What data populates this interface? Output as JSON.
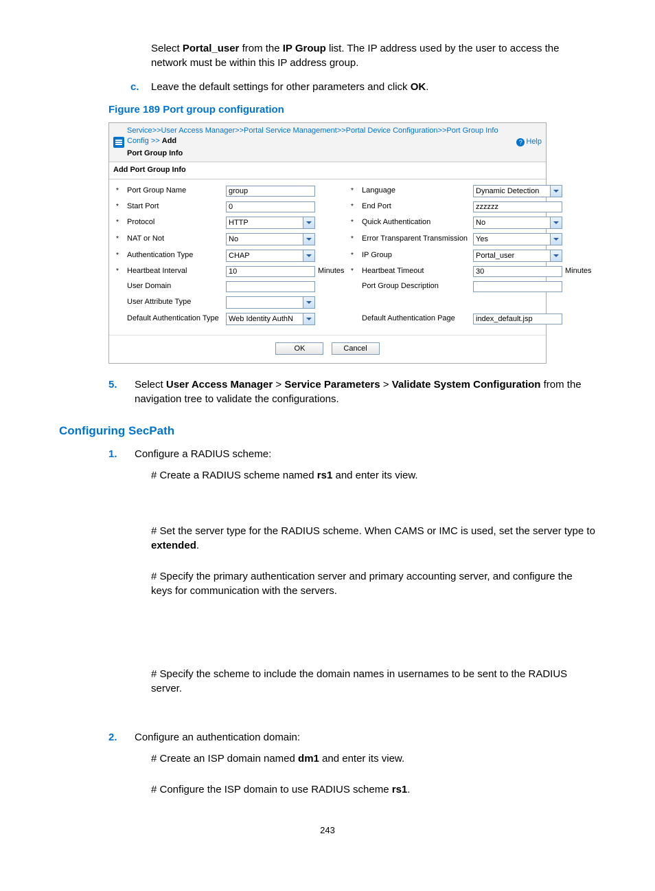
{
  "intro": {
    "para1_a": "Select ",
    "para1_b": "Portal_user",
    "para1_c": " from the ",
    "para1_d": "IP Group",
    "para1_e": " list. The IP address used by the user to access the network must be within this IP address group."
  },
  "step_c_a": "Leave the default settings for other parameters and click ",
  "step_c_b": "OK",
  "step_c_c": ".",
  "fig_caption": "Figure 189 Port group configuration",
  "breadcrumb": {
    "items": [
      "Service",
      "User Access Manager",
      "Portal Service Management",
      "Portal Device Configuration",
      "Port Group Info Config"
    ],
    "sep": ">>",
    "current": "Add",
    "title": "Port Group Info",
    "help": "Help"
  },
  "form_header": "Add Port Group Info",
  "fields": {
    "port_group_name": {
      "label": "Port Group Name",
      "value": "group"
    },
    "language": {
      "label": "Language",
      "value": "Dynamic Detection"
    },
    "start_port": {
      "label": "Start Port",
      "value": "0"
    },
    "end_port": {
      "label": "End Port",
      "value": "zzzzzz"
    },
    "protocol": {
      "label": "Protocol",
      "value": "HTTP"
    },
    "quick_auth": {
      "label": "Quick Authentication",
      "value": "No"
    },
    "nat_or_not": {
      "label": "NAT or Not",
      "value": "No"
    },
    "err_trans": {
      "label": "Error Transparent Transmission",
      "value": "Yes"
    },
    "auth_type": {
      "label": "Authentication Type",
      "value": "CHAP"
    },
    "ip_group": {
      "label": "IP Group",
      "value": "Portal_user"
    },
    "heartbeat_interval": {
      "label": "Heartbeat Interval",
      "value": "10",
      "unit": "Minutes"
    },
    "heartbeat_timeout": {
      "label": "Heartbeat Timeout",
      "value": "30",
      "unit": "Minutes"
    },
    "user_domain": {
      "label": "User Domain",
      "value": ""
    },
    "port_group_desc": {
      "label": "Port Group Description",
      "value": ""
    },
    "user_attr_type": {
      "label": "User Attribute Type",
      "value": ""
    },
    "default_auth_type": {
      "label": "Default Authentication Type",
      "value": "Web Identity AuthN"
    },
    "default_auth_page": {
      "label": "Default Authentication Page",
      "value": "index_default.jsp"
    }
  },
  "buttons": {
    "ok": "OK",
    "cancel": "Cancel"
  },
  "step5": {
    "a": "Select ",
    "b": "User Access Manager",
    "c": " > ",
    "d": "Service Parameters",
    "e": " > ",
    "f": "Validate System Configuration",
    "g": " from the navigation tree to validate the configurations."
  },
  "heading_secpath": "Configuring SecPath",
  "sp_step1": "Configure a RADIUS scheme:",
  "sp_hash1_a": "# Create a RADIUS scheme named ",
  "sp_hash1_b": "rs1",
  "sp_hash1_c": " and enter its view.",
  "sp_hash2_a": "# Set the server type for the RADIUS scheme. When CAMS or IMC is used, set the server type to ",
  "sp_hash2_b": "extended",
  "sp_hash2_c": ".",
  "sp_hash3": "# Specify the primary authentication server and primary accounting server, and configure the keys for communication with the servers.",
  "sp_hash4": "# Specify the scheme to include the domain names in usernames to be sent to the RADIUS server.",
  "sp_step2": "Configure an authentication domain:",
  "sp_hash5_a": "# Create an ISP domain named ",
  "sp_hash5_b": "dm1",
  "sp_hash5_c": " and enter its view.",
  "sp_hash6_a": "# Configure the ISP domain to use RADIUS scheme ",
  "sp_hash6_b": "rs1",
  "sp_hash6_c": ".",
  "page_number": "243",
  "markers": {
    "c": "c.",
    "n5": "5.",
    "n1": "1.",
    "n2": "2."
  }
}
